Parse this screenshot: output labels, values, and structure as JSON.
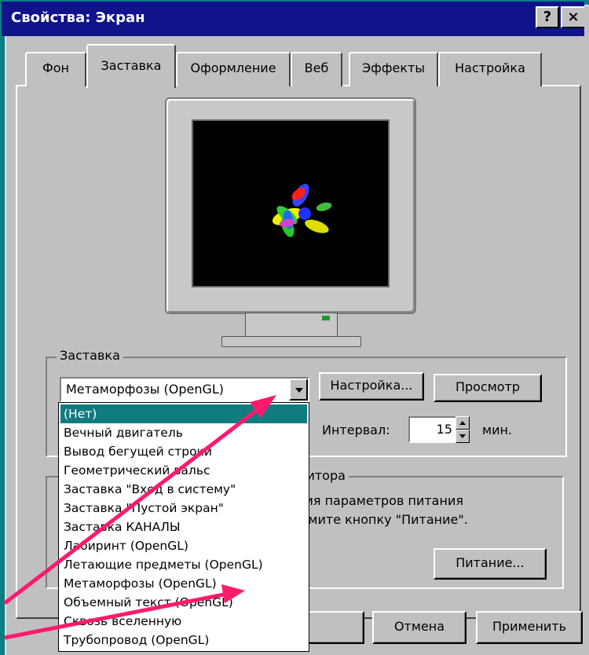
{
  "window": {
    "title": "Свойства: Экран",
    "help_label": "?",
    "close_label": "×"
  },
  "tabs": [
    {
      "label": "Фон"
    },
    {
      "label": "Заставка"
    },
    {
      "label": "Оформление"
    },
    {
      "label": "Веб"
    },
    {
      "label": "Эффекты"
    },
    {
      "label": "Настройка"
    }
  ],
  "screensaver": {
    "group_label": "Заставка",
    "selected": "Метаморфозы (OpenGL)",
    "settings_button": "Настройка...",
    "preview_button": "Просмотр",
    "interval_label": "Интервал:",
    "interval_value": "15",
    "interval_unit": "мин.",
    "options": [
      "(Нет)",
      "Вечный двигатель",
      "Вывод бегущей строки",
      "Геометрический вальс",
      "Заставка \"Вход в систему\"",
      "Заставка \"Пустой экран\"",
      "Заставка КАНАЛЫ",
      "Лабиринт (OpenGL)",
      "Летающие предметы (OpenGL)",
      "Метаморфозы (OpenGL)",
      "Объемный текст (OpenGL)",
      "Сквозь вселенную",
      "Трубопровод (OpenGL)"
    ]
  },
  "power": {
    "group_label_visible": "нитора",
    "line1_visible": "ния параметров питания",
    "line2_visible": "жмите кнопку \"Питание\".",
    "power_button": "Питание..."
  },
  "footer": {
    "cancel_button": "Отмена",
    "apply_button": "Применить"
  },
  "colors": {
    "desktop": "#0a7d84",
    "titlebar": "#10148a",
    "selection": "#117c80",
    "annotation_arrow": "#ff1a6e"
  }
}
